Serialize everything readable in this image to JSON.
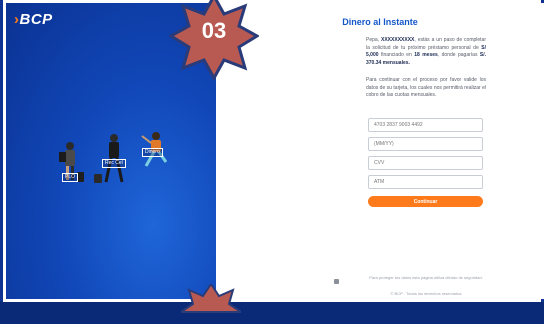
{
  "brand": {
    "logo_text": "BCP",
    "logo_chevrons": "›",
    "accent": "#ff7a1a",
    "primary": "#1458c8"
  },
  "badge": {
    "number": "03",
    "color": "#b85a52"
  },
  "illustration": {
    "labels": [
      "PLO",
      "Rec Cel",
      "Dinero"
    ]
  },
  "form": {
    "title": "Dinero al Instante",
    "intro_prefix": "Pepa,",
    "intro_name": "XXXXXXXXXX",
    "intro_mid": ", estás a un paso de completar la solicitud de tu próximo préstamo personal de",
    "amount": "S/ 5,000",
    "intro_mid2": "financiado en",
    "term": "18 meses",
    "intro_mid3": ", donde pagarías",
    "monthly": "S/. 370.34 mensuales.",
    "instructions": "Para continuar con el proceso por favor valide los datos de su tarjeta, los cuales nos permitirá realizar el cobro de las cuotas mensuales.",
    "card_placeholder": "4703 2837 9003 4492",
    "expiry_placeholder": "(MM/YY)",
    "cvv_placeholder": "CVV",
    "atm_placeholder": "ATM",
    "submit_label": "Continuar"
  },
  "footer": {
    "line1": "Para proteger tus datos esta pagina utiliza cifrado de seguridad.",
    "line2": "© BCP - Todos los derechos reservados"
  }
}
